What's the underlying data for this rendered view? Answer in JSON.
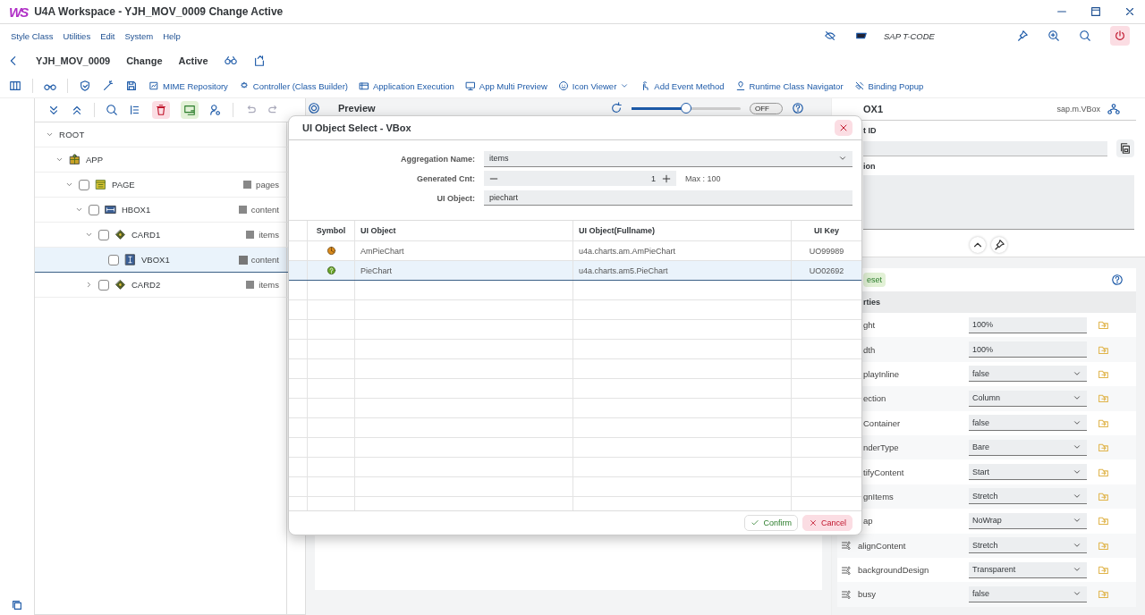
{
  "window": {
    "logo": "WS",
    "title": "U4A Workspace - YJH_MOV_0009 Change Active"
  },
  "header_tools": {
    "tcode_placeholder": "SAP T-CODE"
  },
  "menu": [
    "Style Class",
    "Utilities",
    "Edit",
    "System",
    "Help"
  ],
  "app_bar": {
    "name": "YJH_MOV_0009",
    "mode": "Change",
    "status": "Active"
  },
  "toolbar": [
    {
      "label": "MIME Repository",
      "dropdown": false
    },
    {
      "label": "Controller (Class Builder)",
      "dropdown": false
    },
    {
      "label": "Application Execution",
      "dropdown": false
    },
    {
      "label": "App Multi Preview",
      "dropdown": false
    },
    {
      "label": "Icon Viewer",
      "dropdown": true
    },
    {
      "label": "Add Event Method",
      "dropdown": false
    },
    {
      "label": "Runtime Class Navigator",
      "dropdown": false
    },
    {
      "label": "Binding Popup",
      "dropdown": false
    }
  ],
  "tree": [
    {
      "label": "ROOT",
      "kind": "root",
      "expanded": true,
      "selected": false,
      "children": [
        {
          "label": "APP",
          "kind": "app",
          "expanded": true,
          "selected": false,
          "children": [
            {
              "label": "PAGE",
              "kind": "page",
              "expanded": true,
              "checked": false,
              "selected": false,
              "aggregation": "pages",
              "children": [
                {
                  "label": "HBOX1",
                  "kind": "hbox",
                  "expanded": true,
                  "checked": false,
                  "selected": false,
                  "aggregation": "content",
                  "children": [
                    {
                      "label": "CARD1",
                      "kind": "card",
                      "expanded": true,
                      "checked": false,
                      "selected": false,
                      "aggregation": "items",
                      "children": [
                        {
                          "label": "VBOX1",
                          "kind": "vbox",
                          "checked": false,
                          "selected": true,
                          "aggregation": "content"
                        }
                      ]
                    },
                    {
                      "label": "CARD2",
                      "kind": "card",
                      "expanded": false,
                      "checked": false,
                      "selected": false,
                      "aggregation": "items"
                    }
                  ]
                }
              ]
            }
          ]
        }
      ]
    }
  ],
  "preview": {
    "title": "Preview",
    "zoom": {
      "level": 0.5
    },
    "toggle": {
      "label": "OFF",
      "on": false
    }
  },
  "dialog": {
    "title": "UI Object Select - VBox",
    "aggregation": {
      "label": "Aggregation Name:",
      "value": "items"
    },
    "generated": {
      "label": "Generated Cnt:",
      "value": "1",
      "max": "Max : 100"
    },
    "ui_object": {
      "label": "UI Object:",
      "value": "piechart"
    },
    "columns": [
      "Symbol",
      "UI Object",
      "UI Object(Fullname)",
      "UI Key"
    ],
    "rows": [
      {
        "kind": "chart",
        "name": "AmPieChart",
        "fullname": "u4a.charts.am.AmPieChart",
        "key": "UO99989",
        "selected": false
      },
      {
        "kind": "unknown",
        "name": "PieChart",
        "fullname": "u4a.charts.am5.PieChart",
        "key": "UO02692",
        "selected": true
      }
    ],
    "buttons": [
      {
        "label": "Confirm",
        "kind": "confirm"
      },
      {
        "label": "Cancel",
        "kind": "cancel"
      }
    ]
  },
  "details": {
    "title": "OX1",
    "class": "sap.m.VBox",
    "id_label": "t ID",
    "description_label": "ion",
    "reset": "eset",
    "section": "rties",
    "properties": [
      {
        "label": "ght",
        "kind": "input",
        "value": "100%",
        "label_icon": false
      },
      {
        "label": "dth",
        "kind": "input",
        "value": "100%",
        "label_icon": false
      },
      {
        "label": "playInline",
        "kind": "select",
        "value": "false",
        "label_icon": false
      },
      {
        "label": "ection",
        "kind": "select",
        "value": "Column",
        "label_icon": false
      },
      {
        "label": "Container",
        "kind": "select",
        "value": "false",
        "label_icon": false
      },
      {
        "label": "nderType",
        "kind": "select",
        "value": "Bare",
        "label_icon": false
      },
      {
        "label": "tifyContent",
        "kind": "select",
        "value": "Start",
        "label_icon": false
      },
      {
        "label": "gnItems",
        "kind": "select",
        "value": "Stretch",
        "label_icon": false
      },
      {
        "label": "ap",
        "kind": "select",
        "value": "NoWrap",
        "label_icon": false
      },
      {
        "label": "alignContent",
        "kind": "select",
        "value": "Stretch",
        "label_icon": true
      },
      {
        "label": "backgroundDesign",
        "kind": "select",
        "value": "Transparent",
        "label_icon": true
      },
      {
        "label": "busy",
        "kind": "select",
        "value": "false",
        "label_icon": true
      }
    ]
  }
}
